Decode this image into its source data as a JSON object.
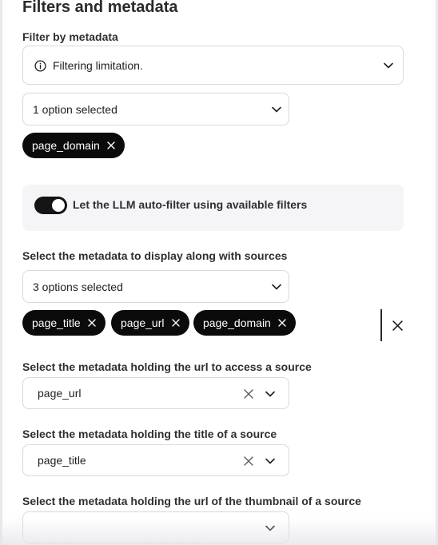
{
  "page": {
    "heading": "Filters and metadata"
  },
  "filter_section": {
    "label": "Filter by metadata",
    "limitation_text": "Filtering limitation.",
    "select_value": "1 option selected",
    "chips": [
      "page_domain"
    ]
  },
  "auto_filter": {
    "label": "Let the LLM auto-filter using available filters",
    "enabled": true
  },
  "display_section": {
    "label": "Select the metadata to display along with sources",
    "select_value": "3 options selected",
    "chips": [
      "page_title",
      "page_url",
      "page_domain"
    ]
  },
  "url_section": {
    "label": "Select the metadata holding the url to access a source",
    "value": "page_url"
  },
  "title_section": {
    "label": "Select the metadata holding the title of a source",
    "value": "page_title"
  },
  "thumbnail_section": {
    "label": "Select the metadata holding the url of the thumbnail of a source",
    "value": ""
  },
  "icons": {
    "info": "info-icon",
    "chevron": "chevron-down-icon",
    "close": "close-icon"
  },
  "colors": {
    "chip_bg": "#0b0b0b",
    "panel_bg": "#f5f5f7",
    "border": "#d9d9de"
  }
}
